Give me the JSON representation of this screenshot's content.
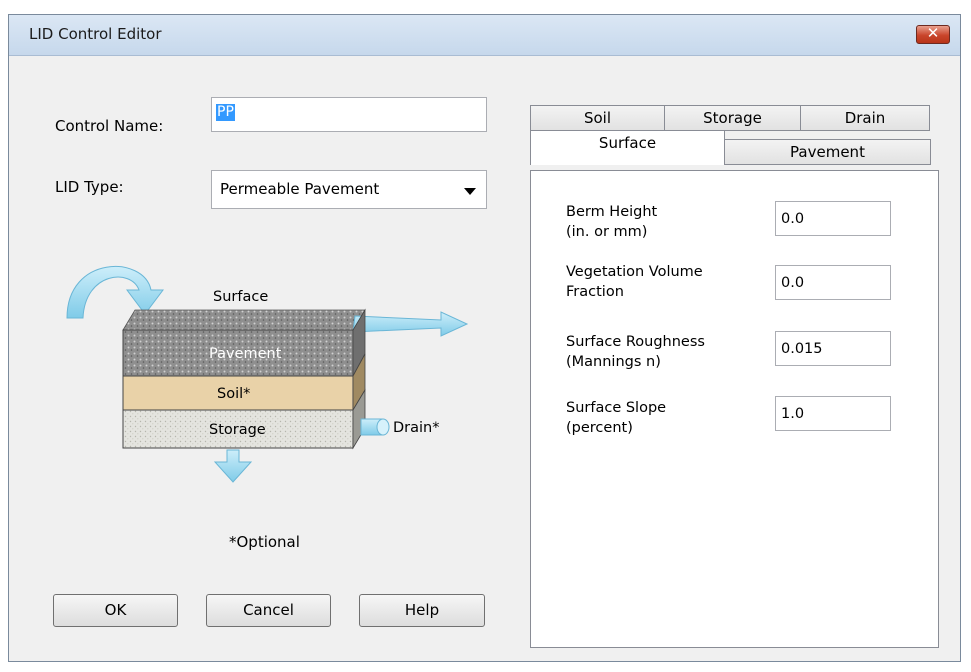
{
  "window": {
    "title": "LID Control Editor",
    "close_symbol": "✕"
  },
  "form": {
    "control_name_label": "Control Name:",
    "control_name_value": "PP",
    "lid_type_label": "LID Type:",
    "lid_type_value": "Permeable Pavement"
  },
  "diagram": {
    "surface": "Surface",
    "pavement": "Pavement",
    "soil": "Soil*",
    "storage": "Storage",
    "drain": "Drain*",
    "optional_note": "*Optional"
  },
  "buttons": {
    "ok": "OK",
    "cancel": "Cancel",
    "help": "Help"
  },
  "tabs": {
    "back_row": [
      "Soil",
      "Storage",
      "Drain"
    ],
    "front_row": [
      "Surface",
      "Pavement"
    ],
    "active": "Surface"
  },
  "surface_fields": [
    {
      "line1": "Berm Height",
      "line2": "(in. or mm)",
      "value": "0.0"
    },
    {
      "line1": "Vegetation Volume",
      "line2": "Fraction",
      "value": "0.0"
    },
    {
      "line1": "Surface Roughness",
      "line2": "(Mannings n)",
      "value": "0.015"
    },
    {
      "line1": "Surface Slope",
      "line2": "(percent)",
      "value": "1.0"
    }
  ]
}
